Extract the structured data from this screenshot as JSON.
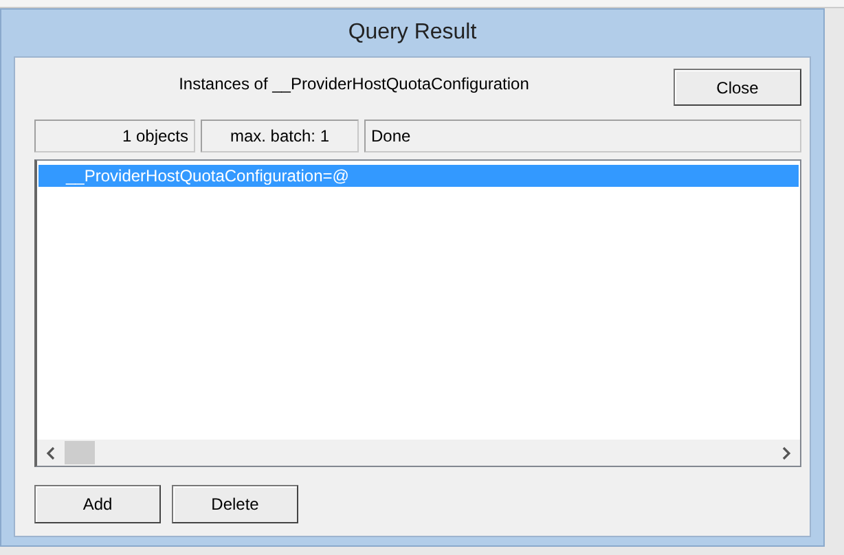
{
  "window": {
    "title": "Query Result"
  },
  "heading": "Instances of __ProviderHostQuotaConfiguration",
  "close_button": "Close",
  "status": [
    "1 objects",
    "max. batch: 1",
    "Done"
  ],
  "list": {
    "items": [
      {
        "label": "__ProviderHostQuotaConfiguration=@",
        "selected": true
      }
    ]
  },
  "buttons": [
    "Add",
    "Delete"
  ]
}
